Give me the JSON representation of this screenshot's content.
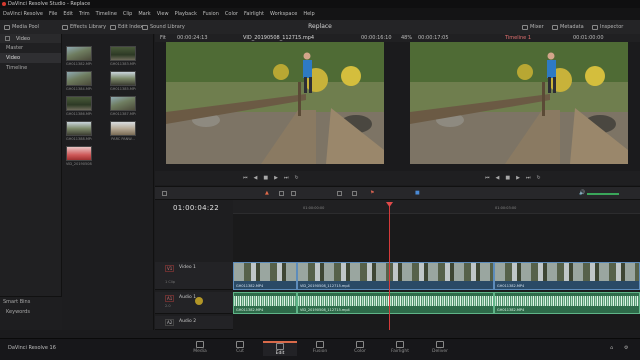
{
  "titlebar": {
    "title": "DaVinci Resolve Studio - Replace"
  },
  "menu": [
    "DaVinci Resolve",
    "File",
    "Edit",
    "Trim",
    "Timeline",
    "Clip",
    "Mark",
    "View",
    "Playback",
    "Fusion",
    "Color",
    "Fairlight",
    "Workspace",
    "Help"
  ],
  "toolbar": {
    "media_pool": "Media Pool",
    "effects_library": "Effects Library",
    "edit_index": "Edit Index",
    "sound_library": "Sound Library",
    "page_title": "Replace",
    "mixer": "Mixer",
    "metadata": "Metadata",
    "inspector": "Inspector"
  },
  "bins": {
    "breadcrumb": "Video",
    "items": [
      "Master",
      "Video",
      "Timeline"
    ],
    "selected": "Video",
    "smart_bins": "Smart Bins",
    "keywords": "Keywords"
  },
  "clips": [
    {
      "name": "GH011382.MP4"
    },
    {
      "name": "GH011383.MP4"
    },
    {
      "name": "GH011384.MP4"
    },
    {
      "name": "GH011385.MP4"
    },
    {
      "name": "GH011386.MP4"
    },
    {
      "name": "GH011387.MP4"
    },
    {
      "name": "GH011388.MP4"
    },
    {
      "name": "PARC PANW..."
    },
    {
      "name": "VID_20190508..."
    }
  ],
  "source_viewer": {
    "zoom": "Fit",
    "timecode_left": "00:00:24:13",
    "clip_name": "VID_20190508_112715.mp4",
    "timecode_right": "00:00:16:10"
  },
  "timeline_viewer": {
    "zoom": "48%",
    "timecode_left": "00:00:17:05",
    "timeline_name": "Timeline 1",
    "timecode_right": "00:01:00:00"
  },
  "timeline": {
    "timecode": "01:00:04:22",
    "ruler": [
      "01:00:00:00",
      "01:00:03:00"
    ],
    "tracks": [
      {
        "tag": "V1",
        "name": "Video 1",
        "sub": "1 Clip"
      },
      {
        "tag": "A1",
        "name": "Audio 1",
        "sub": "2.0"
      },
      {
        "tag": "A2",
        "name": "Audio 2",
        "sub": "2.0"
      }
    ],
    "video_clips": [
      "GH011382.MP4",
      "VID_20190508_112715.mp4",
      "GH011382.MP4"
    ],
    "audio_clips": [
      "GH011382.MP4",
      "VID_20190508_112715.mp4",
      "GH011382.MP4"
    ]
  },
  "pages": [
    "Media",
    "Cut",
    "Edit",
    "Fusion",
    "Color",
    "Fairlight",
    "Deliver"
  ],
  "active_page": "Edit",
  "brand": "DaVinci Resolve 16",
  "colors": {
    "accent": "#d96a4a",
    "playhead": "#d43a3a",
    "video_clip": "#2a4a66",
    "audio_clip": "#2e6b4a"
  }
}
